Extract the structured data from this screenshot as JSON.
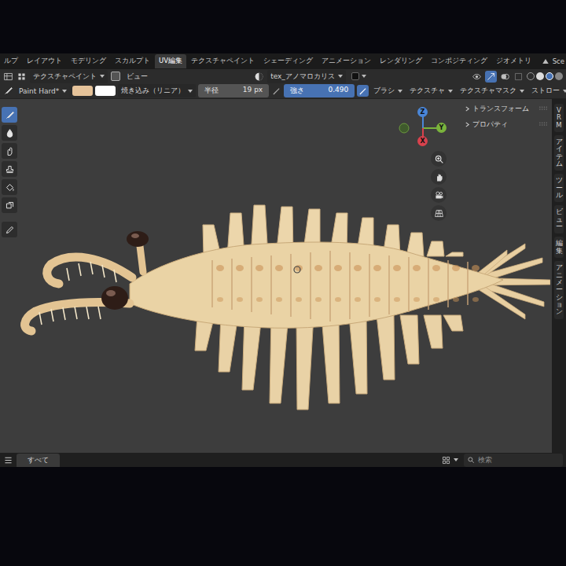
{
  "workspace_tabs": [
    {
      "label": "ルプ",
      "selected": false
    },
    {
      "label": "レイアウト",
      "selected": false
    },
    {
      "label": "モデリング",
      "selected": false
    },
    {
      "label": "スカルプト",
      "selected": false
    },
    {
      "label": "UV編集",
      "selected": true
    },
    {
      "label": "テクスチャペイント",
      "selected": false
    },
    {
      "label": "シェーディング",
      "selected": false
    },
    {
      "label": "アニメーション",
      "selected": false
    },
    {
      "label": "レンダリング",
      "selected": false
    },
    {
      "label": "コンポジティング",
      "selected": false
    },
    {
      "label": "ジオメトリ",
      "selected": false
    }
  ],
  "scene_label": "Sce",
  "header": {
    "mode": "テクスチャペイント",
    "view_menu": "ビュー",
    "image": "tex_アノマロカリス"
  },
  "tool_settings": {
    "brush": "Paint Hard*",
    "colors": [
      {
        "color": "#e6c39a"
      },
      {
        "color": "#ffffff"
      }
    ],
    "blend": "焼き込み（リニア）",
    "radius": {
      "label": "半径",
      "value": "19 px",
      "selected": false
    },
    "strength": {
      "label": "強さ",
      "value": "0.490",
      "selected": true
    },
    "menus": [
      "ブラシ",
      "テクスチャ",
      "テクスチャマスク",
      "ストロー"
    ]
  },
  "toolbar": [
    {
      "selected": true
    },
    {
      "selected": false
    },
    {
      "selected": false
    },
    {
      "selected": false
    },
    {
      "selected": false
    },
    {
      "selected": false
    },
    {
      "selected": false
    }
  ],
  "sidebar_panels": [
    {
      "label": "トランスフォーム",
      "expanded": false
    },
    {
      "label": "プロパティ",
      "expanded": false
    }
  ],
  "sidebar_tabs": [
    {
      "label": "VRM",
      "selected": false
    },
    {
      "label": "アイテム",
      "selected": false
    },
    {
      "label": "ツール",
      "selected": false
    },
    {
      "label": "ビュー",
      "selected": false
    },
    {
      "label": "編集",
      "selected": false
    },
    {
      "label": "アニメーション",
      "selected": false
    }
  ],
  "gizmo": {
    "z": "Z",
    "y": "Y",
    "x": "X"
  },
  "status_bar": {
    "filter_tab": "すべて",
    "search": {
      "placeholder": "検索"
    }
  }
}
